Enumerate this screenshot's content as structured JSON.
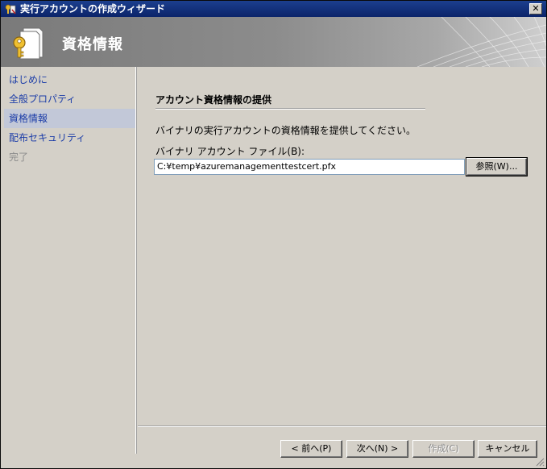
{
  "window": {
    "title": "実行アカウントの作成ウィザード",
    "close_label": "✕"
  },
  "banner": {
    "title": "資格情報",
    "icon": "certificate-key-icon"
  },
  "nav": {
    "items": [
      {
        "label": "はじめに",
        "state": "normal"
      },
      {
        "label": "全般プロパティ",
        "state": "normal"
      },
      {
        "label": "資格情報",
        "state": "selected"
      },
      {
        "label": "配布セキュリティ",
        "state": "normal"
      },
      {
        "label": "完了",
        "state": "disabled"
      }
    ]
  },
  "content": {
    "section_title": "アカウント資格情報の提供",
    "description": "バイナリの実行アカウントの資格情報を提供してください。",
    "field_label": "バイナリ アカウント ファイル(B):",
    "field_value": "C:¥temp¥azuremanagementtestcert.pfx",
    "browse_label": "参照(W)..."
  },
  "footer": {
    "prev_label": "< 前へ(P)",
    "next_label": "次へ(N) >",
    "finish_label": "作成(C)",
    "cancel_label": "キャンセル"
  },
  "colors": {
    "title_bar": "#0b246a",
    "nav_link": "#1c3da8",
    "nav_selected_bg": "#c2c8d8",
    "dialog_bg": "#d4d0c8"
  }
}
